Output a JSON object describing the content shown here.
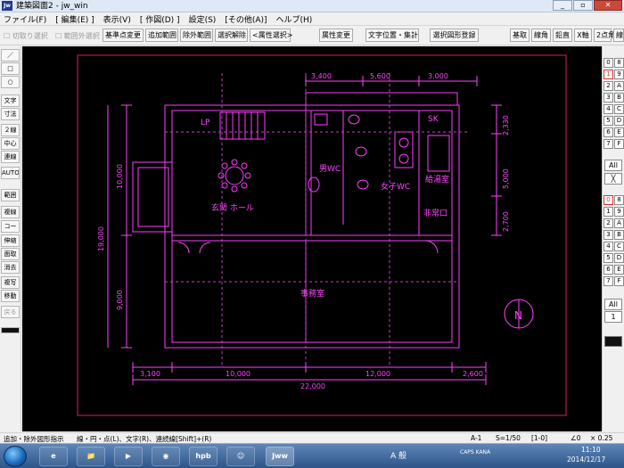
{
  "window": {
    "title": "建築図面2 - jw_win",
    "app_icon": "Jw",
    "minimize": "_",
    "maximize": "▫",
    "close": "✕"
  },
  "menu": [
    "ファイル(F)",
    "[ 編集(E) ]",
    "表示(V)",
    "[ 作図(D) ]",
    "設定(S)",
    "[その他(A)]",
    "ヘルプ(H)"
  ],
  "toolbar": {
    "check1": "切取り選択",
    "check2": "範囲外選択",
    "buttons": [
      "基準点変更",
      "追加範囲",
      "除外範囲",
      "選択解除",
      "<属性選択>",
      "属性変更",
      "文字位置・集計",
      "選択図形登録"
    ],
    "right_buttons": [
      "基取",
      "線角",
      "鉛直",
      "X軸",
      "2点角",
      "線"
    ]
  },
  "left_tools": [
    "／",
    "□",
    "○",
    "文字",
    "寸法",
    "２線",
    "中心線",
    "連線",
    "AUTO",
    "範囲",
    "複線",
    "コーナー",
    "伸縮",
    "面取",
    "消去",
    "複写",
    "移動",
    "戻る"
  ],
  "right_layers": {
    "group_a": [
      "0",
      "8",
      "1",
      "9",
      "2",
      "A",
      "3",
      "B",
      "4",
      "C",
      "5",
      "D",
      "6",
      "E",
      "7",
      "F"
    ],
    "all_a": "All",
    "x_a": "╳",
    "group_b": [
      "0",
      "8",
      "1",
      "9",
      "2",
      "A",
      "3",
      "B",
      "4",
      "C",
      "5",
      "D",
      "6",
      "E",
      "7",
      "F"
    ],
    "all_b": "All",
    "num_b": "1"
  },
  "drawing": {
    "dims_top": [
      "3,400",
      "5,600",
      "3,000"
    ],
    "dims_right": [
      "2,330",
      "5,000",
      "2,700"
    ],
    "dims_left": [
      "10,000",
      "19,000",
      "9,000"
    ],
    "dims_bottom": [
      "3,100",
      "10,000",
      "12,000",
      "2,600"
    ],
    "dim_total": "22,000",
    "rooms": {
      "lp": "LP",
      "sk": "SK",
      "men_wc": "男WC",
      "women_wc": "女子WC",
      "kitchenette": "給湯室",
      "entrance_hall": "玄関 ホール",
      "emergency_exit": "非常口",
      "office": "事務室"
    },
    "north": "N",
    "colors": {
      "wall": "#ff3cff",
      "dim": "#ff44ff",
      "frame": "#d8206a"
    }
  },
  "status": {
    "hint": "追加・除外図形指示",
    "hint2": "線・円・点(L)、文字(R)、連続線[Shift]+(R)",
    "paper": "A-1",
    "scale": "S=1/50",
    "layer": "[1-0]",
    "angle": "∠0",
    "factor": "× 0.25"
  },
  "taskbar": {
    "apps": [
      "e",
      "📁",
      "▶",
      "◉",
      "hpb",
      "☺",
      "Jww"
    ],
    "ime": "A 般",
    "caps": "CAPS KANA",
    "time": "11:10",
    "date": "2014/12/17"
  }
}
